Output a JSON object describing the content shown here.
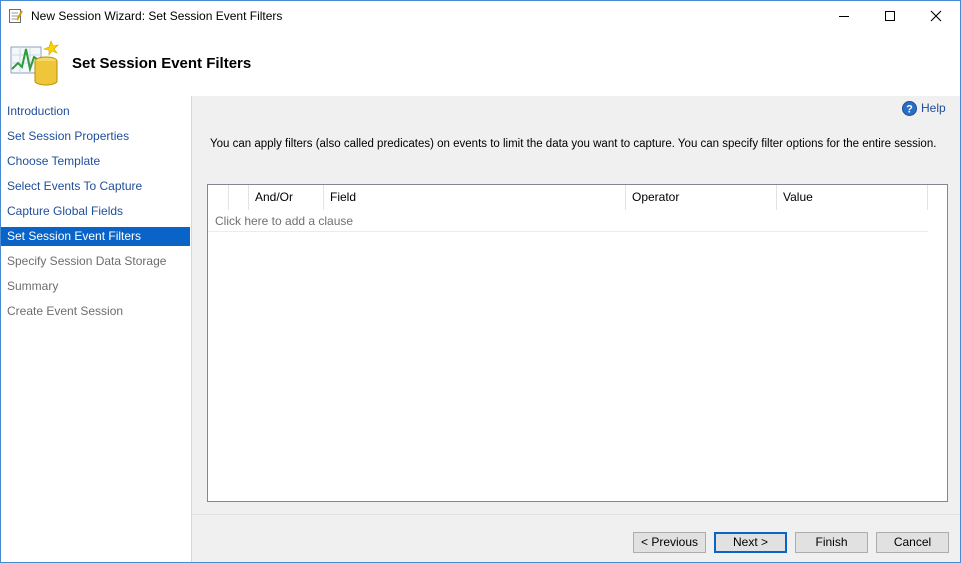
{
  "window": {
    "title": "New Session Wizard: Set Session Event Filters"
  },
  "header": {
    "title": "Set Session Event Filters"
  },
  "sidebar": {
    "items": [
      {
        "label": "Introduction",
        "state": "enabled"
      },
      {
        "label": "Set Session Properties",
        "state": "enabled"
      },
      {
        "label": "Choose Template",
        "state": "enabled"
      },
      {
        "label": "Select Events To Capture",
        "state": "enabled"
      },
      {
        "label": "Capture Global Fields",
        "state": "enabled"
      },
      {
        "label": "Set Session Event Filters",
        "state": "active"
      },
      {
        "label": "Specify Session Data Storage",
        "state": "disabled"
      },
      {
        "label": "Summary",
        "state": "disabled"
      },
      {
        "label": "Create Event Session",
        "state": "disabled"
      }
    ]
  },
  "main": {
    "help_label": "Help",
    "description": "You can apply filters (also called predicates) on events to limit the data you want to capture. You can specify filter options for the entire session.",
    "grid": {
      "columns": [
        "And/Or",
        "Field",
        "Operator",
        "Value"
      ],
      "add_clause_text": "Click here to add a clause"
    }
  },
  "footer": {
    "previous_label": "< Previous",
    "next_label": "Next >",
    "finish_label": "Finish",
    "cancel_label": "Cancel"
  },
  "colors": {
    "accent": "#0a64c8",
    "link": "#1f4e9a",
    "disabled_text": "#6d6d6d",
    "panel_background": "#f0f0f0"
  },
  "icons": {
    "app": "wizard-app-icon",
    "header": "extended-events-database-icon",
    "help": "help-icon",
    "minimize": "minimize-icon",
    "maximize": "maximize-icon",
    "close": "close-icon"
  }
}
